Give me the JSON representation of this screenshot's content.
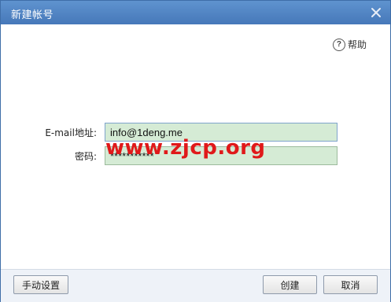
{
  "window": {
    "title": "新建帐号",
    "close_icon": "close-icon"
  },
  "help": {
    "icon": "question-circle-icon",
    "label": "帮助"
  },
  "form": {
    "email_label": "E-mail地址:",
    "email_value": "info@1deng.me",
    "password_label": "密码:",
    "password_value": "***********",
    "field_background": "#d5ebd5"
  },
  "watermark": {
    "text": "www.zjcp.org",
    "color": "#e0191a"
  },
  "buttons": {
    "manual_label": "手动设置",
    "create_label": "创建",
    "cancel_label": "取消"
  },
  "colors": {
    "titlebar": "#4f82c2",
    "footer": "#eef2f8"
  }
}
